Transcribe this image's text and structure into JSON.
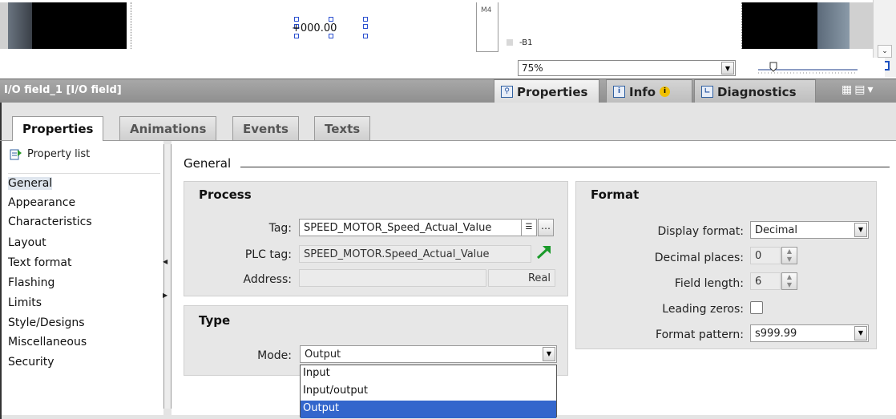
{
  "canvas": {
    "io_field_value": "+000.00",
    "m4_label": "M4",
    "b1_label": "-B1",
    "zoom": "75%"
  },
  "inspector": {
    "title": "I/O field_1 [I/O field]",
    "tabs": {
      "properties": "Properties",
      "info": "Info",
      "diagnostics": "Diagnostics"
    },
    "subtabs": [
      "Properties",
      "Animations",
      "Events",
      "Texts"
    ],
    "property_list_label": "Property list",
    "list_items": [
      "General",
      "Appearance",
      "Characteristics",
      "Layout",
      "Text format",
      "Flashing",
      "Limits",
      "Style/Designs",
      "Miscellaneous",
      "Security"
    ],
    "selected_item": "General"
  },
  "general": {
    "title": "General",
    "process": {
      "title": "Process",
      "tag_label": "Tag:",
      "tag_value": "SPEED_MOTOR_Speed_Actual_Value",
      "plc_tag_label": "PLC tag:",
      "plc_tag_value": "SPEED_MOTOR.Speed_Actual_Value",
      "address_label": "Address:",
      "address_value": "",
      "address_type": "Real"
    },
    "type": {
      "title": "Type",
      "mode_label": "Mode:",
      "mode_value": "Output",
      "mode_options": [
        "Input",
        "Input/output",
        "Output"
      ],
      "mode_selected": "Output"
    },
    "format": {
      "title": "Format",
      "display_format_label": "Display format:",
      "display_format_value": "Decimal",
      "decimal_places_label": "Decimal places:",
      "decimal_places_value": "0",
      "field_length_label": "Field length:",
      "field_length_value": "6",
      "leading_zeros_label": "Leading zeros:",
      "leading_zeros_checked": false,
      "format_pattern_label": "Format pattern:",
      "format_pattern_value": "s999.99"
    }
  },
  "colors": {
    "header_bg": "#9a9a9a",
    "selection": "#3366cc",
    "link_arrow": "#1a9a2a"
  }
}
